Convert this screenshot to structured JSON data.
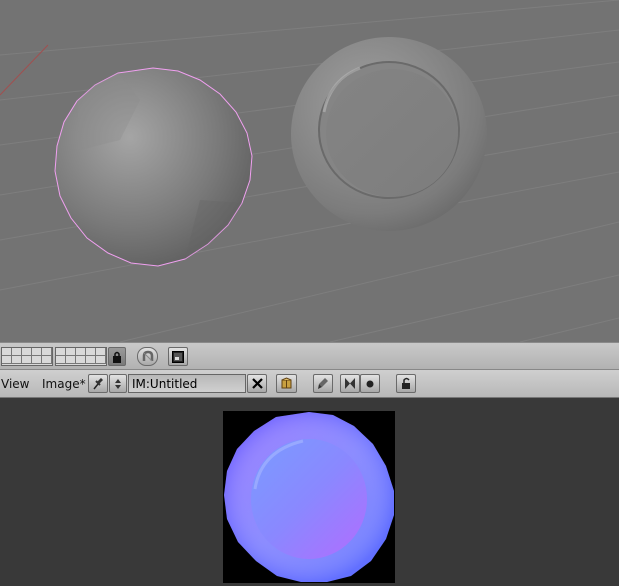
{
  "header1": {
    "lock_icon": "lock-icon",
    "magnet_icon": "magnet-icon",
    "render_icon": "image-render-icon"
  },
  "header2": {
    "menu_view": "View",
    "menu_image": "Image*",
    "image_name": "IM:Untitled"
  },
  "colors": {
    "viewport_bg": "#737373",
    "editor_bg": "#393939",
    "selection_outline": "#f0a0f0",
    "normal_map_blue": "#8080ff"
  }
}
